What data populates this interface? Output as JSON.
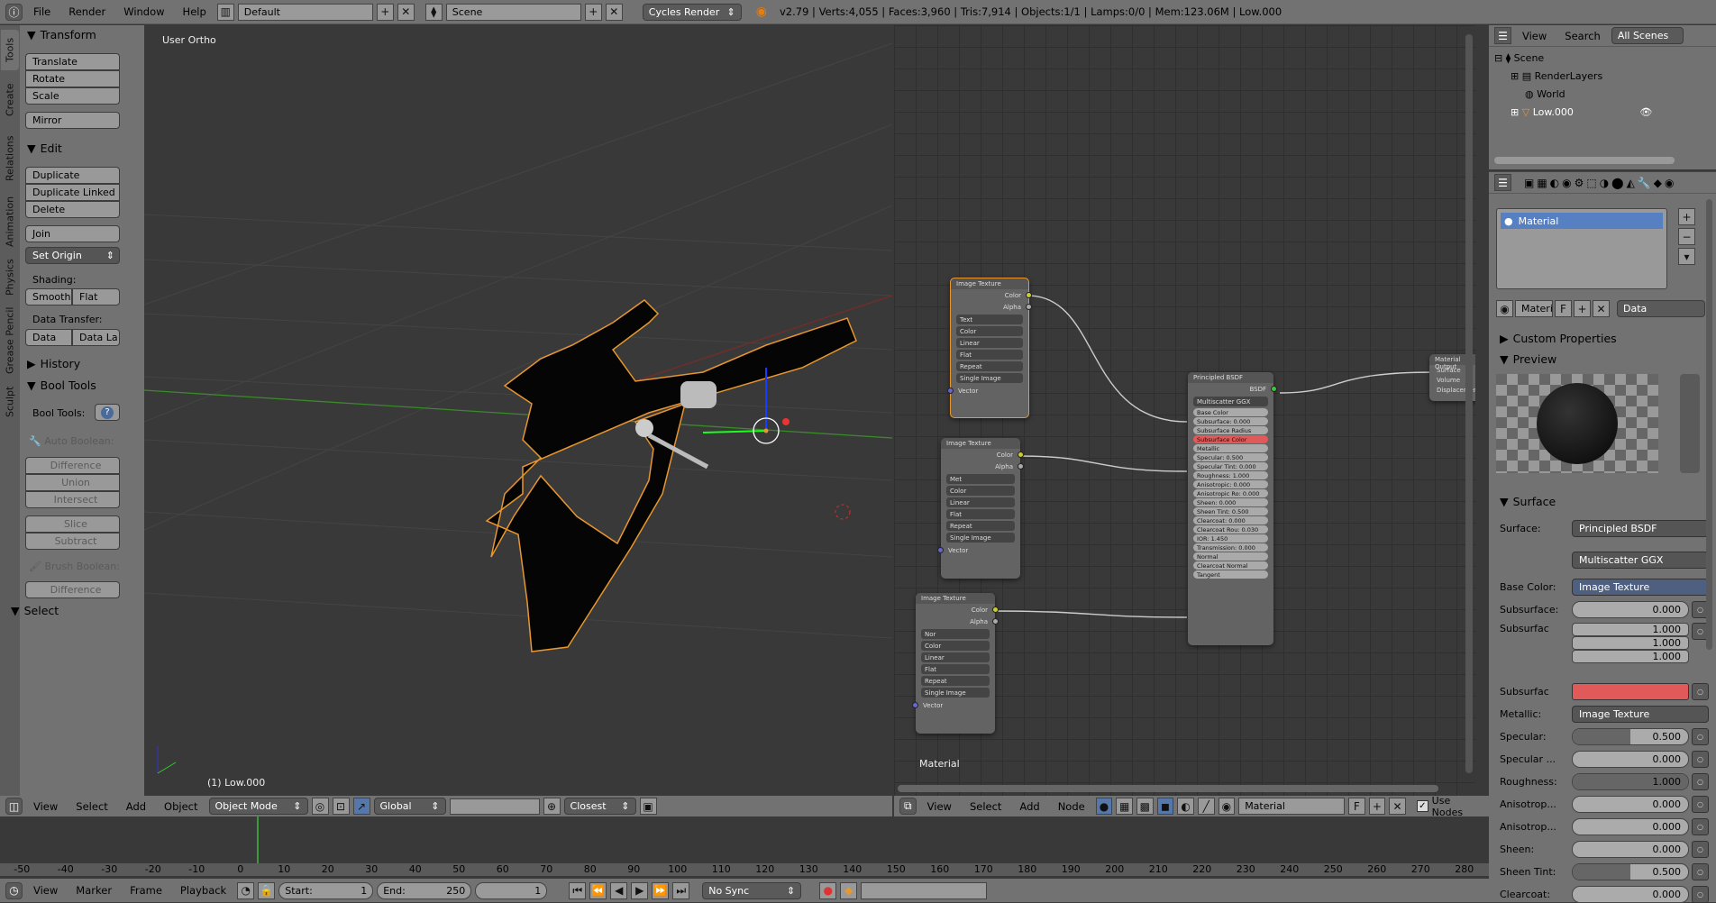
{
  "topbar": {
    "menus": [
      "File",
      "Render",
      "Window",
      "Help"
    ],
    "layout": "Default",
    "scene": "Scene",
    "engine": "Cycles Render",
    "stats": "v2.79 | Verts:4,055 | Faces:3,960 | Tris:7,914 | Objects:1/1 | Lamps:0/0 | Mem:123.06M | Low.000"
  },
  "toolshelf": {
    "tabs": [
      "Tools",
      "Create",
      "Relations",
      "Animation",
      "Physics",
      "Grease Pencil",
      "Sculpt"
    ],
    "transform": {
      "title": "Transform",
      "buttons": [
        "Translate",
        "Rotate",
        "Scale",
        "Mirror"
      ]
    },
    "edit": {
      "title": "Edit",
      "buttons": [
        "Duplicate",
        "Duplicate Linked",
        "Delete",
        "Join"
      ],
      "set_origin": "Set Origin"
    },
    "shading": {
      "label": "Shading:",
      "smooth": "Smooth",
      "flat": "Flat"
    },
    "data_transfer": {
      "label": "Data Transfer:",
      "data": "Data",
      "data_layers": "Data La"
    },
    "history": "History",
    "bool_tools": {
      "title": "Bool Tools",
      "label": "Bool Tools:",
      "auto_boolean": "Auto Boolean:",
      "auto_buttons": [
        "Difference",
        "Union",
        "Intersect",
        "Slice",
        "Subtract"
      ],
      "brush_boolean": "Brush Boolean:",
      "brush_buttons": [
        "Difference"
      ]
    },
    "select": "Select"
  },
  "viewport": {
    "view_label": "User Ortho",
    "object_label": "(1) Low.000",
    "header": {
      "menus": [
        "View",
        "Select",
        "Add",
        "Object"
      ],
      "mode": "Object Mode",
      "orientation": "Global",
      "snap": "Closest"
    }
  },
  "node_editor": {
    "material_label": "Material",
    "header": {
      "menus": [
        "View",
        "Select",
        "Add",
        "Node"
      ],
      "material": "Material",
      "fake_user": "F",
      "use_nodes": "Use Nodes"
    },
    "image_nodes": [
      {
        "title": "Image Texture",
        "image": "Text",
        "color": "Color",
        "interp": "Linear",
        "proj": "Flat",
        "ext": "Repeat",
        "source": "Single Image"
      },
      {
        "title": "Image Texture",
        "image": "Met",
        "color": "Color",
        "interp": "Linear",
        "proj": "Flat",
        "ext": "Repeat",
        "source": "Single Image"
      },
      {
        "title": "Image Texture",
        "image": "Nor",
        "color": "Color",
        "interp": "Linear",
        "proj": "Flat",
        "ext": "Repeat",
        "source": "Single Image"
      }
    ],
    "principled": {
      "title": "Principled BSDF",
      "output": "BSDF",
      "distribution": "Multiscatter GGX",
      "inputs": [
        "Base Color",
        "Subsurface: 0.000",
        "Subsurface Radius",
        "Subsurface Color",
        "Metallic",
        "Specular: 0.500",
        "Specular Tint: 0.000",
        "Roughness: 1.000",
        "Anisotropic: 0.000",
        "Anisotropic Ro: 0.000",
        "Sheen: 0.000",
        "Sheen Tint: 0.500",
        "Clearcoat: 0.000",
        "Clearcoat Rou: 0.030",
        "IOR: 1.450",
        "Transmission: 0.000",
        "Normal",
        "Clearcoat Normal",
        "Tangent"
      ]
    },
    "output_node": {
      "title": "Material Output",
      "sockets": [
        "Surface",
        "Volume",
        "Displacement"
      ]
    }
  },
  "outliner": {
    "menus": [
      "View",
      "Search"
    ],
    "filter": "All Scenes",
    "items": [
      "Scene",
      "RenderLayers",
      "World",
      "Low.000"
    ]
  },
  "properties": {
    "slot": "Material",
    "material_name": "Materi",
    "fake_user": "F",
    "link": "Data",
    "panels": [
      "Custom Properties",
      "Preview",
      "Surface"
    ],
    "surface": {
      "surface_label": "Surface:",
      "surface_value": "Principled BSDF",
      "distribution": "Multiscatter GGX",
      "rows": [
        {
          "label": "Base Color:",
          "type": "link",
          "value": "Image Texture",
          "highlight": true
        },
        {
          "label": "Subsurface:",
          "type": "num",
          "value": "0.000",
          "fill": 0
        },
        {
          "label": "Subsurfac",
          "type": "vec",
          "values": [
            "1.000",
            "1.000",
            "1.000"
          ]
        },
        {
          "label": "Subsurfac",
          "type": "color",
          "color": "#e05a5a"
        },
        {
          "label": "Metallic:",
          "type": "link",
          "value": "Image Texture"
        },
        {
          "label": "Specular:",
          "type": "num",
          "value": "0.500",
          "fill": 0.5
        },
        {
          "label": "Specular ...",
          "type": "num",
          "value": "0.000",
          "fill": 0
        },
        {
          "label": "Roughness:",
          "type": "num",
          "value": "1.000",
          "fill": 1
        },
        {
          "label": "Anisotrop...",
          "type": "num",
          "value": "0.000",
          "fill": 0
        },
        {
          "label": "Anisotrop...",
          "type": "num",
          "value": "0.000",
          "fill": 0
        },
        {
          "label": "Sheen:",
          "type": "num",
          "value": "0.000",
          "fill": 0
        },
        {
          "label": "Sheen Tint:",
          "type": "num",
          "value": "0.500",
          "fill": 0.5
        },
        {
          "label": "Clearcoat:",
          "type": "num",
          "value": "0.000",
          "fill": 0
        }
      ]
    }
  },
  "timeline": {
    "ticks": [
      "-50",
      "-40",
      "-30",
      "-20",
      "-10",
      "0",
      "10",
      "20",
      "30",
      "40",
      "50",
      "60",
      "70",
      "80",
      "90",
      "100",
      "110",
      "120",
      "130",
      "140",
      "150",
      "160",
      "170",
      "180",
      "190",
      "200",
      "210",
      "220",
      "230",
      "240",
      "250",
      "260",
      "270",
      "280"
    ],
    "menus": [
      "View",
      "Marker",
      "Frame",
      "Playback"
    ],
    "start": "Start:",
    "start_val": "1",
    "end": "End:",
    "end_val": "250",
    "current": "1",
    "sync": "No Sync"
  }
}
